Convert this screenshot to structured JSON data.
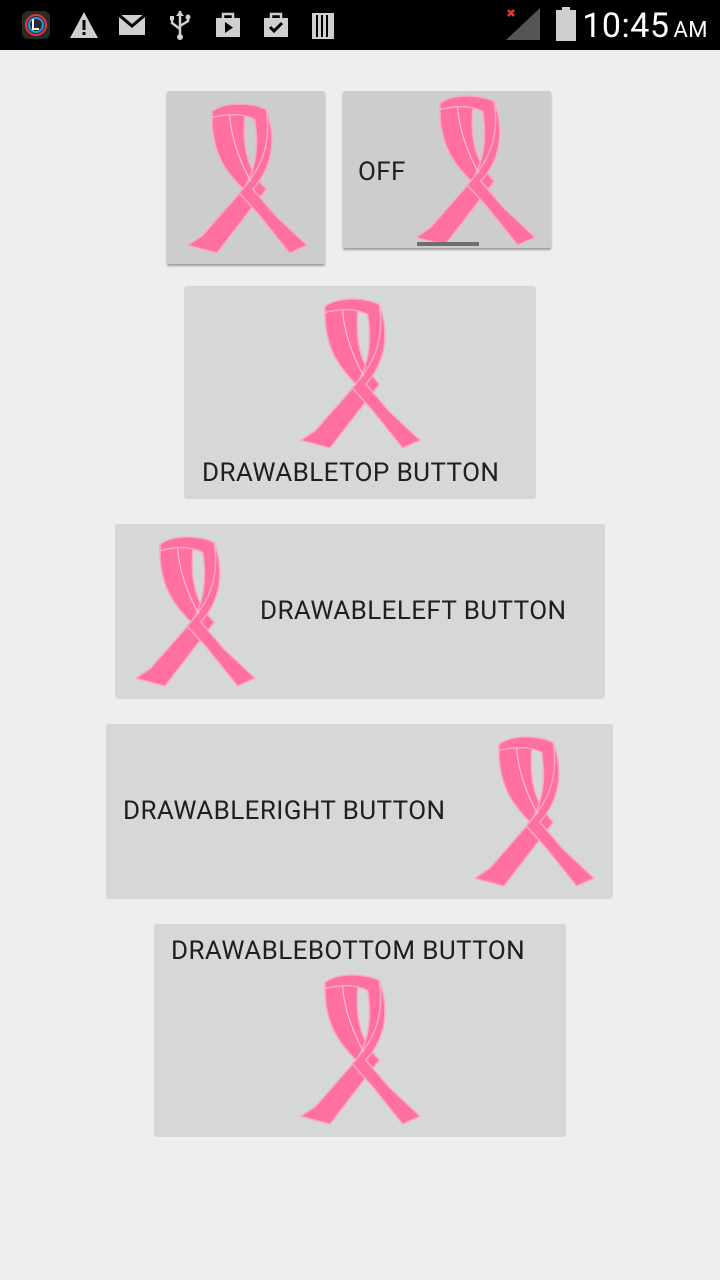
{
  "status_bar": {
    "time": "10:45",
    "ampm": "AM"
  },
  "image_button": {
    "icon": "pink-ribbon-icon"
  },
  "toggle_button": {
    "label": "OFF"
  },
  "buttons": {
    "top_label": "DRAWABLETOP BUTTON",
    "left_label": "DRAWABLELEFT BUTTON",
    "right_label": "DRAWABLERIGHT BUTTON",
    "bottom_label": "DRAWABLEBOTTOM BUTTON"
  },
  "colors": {
    "ribbon": "#ff6fa0",
    "button_bg": "#d6d7d7",
    "background": "#eeeeee"
  }
}
